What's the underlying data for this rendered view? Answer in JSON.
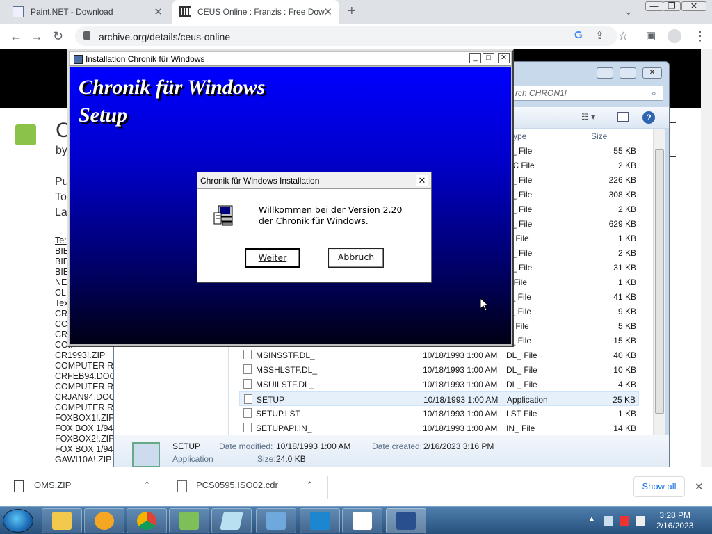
{
  "browser": {
    "tabs": [
      {
        "title": "Paint.NET - Download",
        "close": "✕",
        "active": false
      },
      {
        "title": "CEUS Online : Franzis : Free Dow",
        "close": "✕",
        "active": true
      }
    ],
    "new_tab": "+",
    "url": "archive.org/details/ceus-online",
    "window_controls": [
      "—",
      "❐",
      "✕"
    ]
  },
  "archive_page": {
    "title_partial": "C",
    "by_partial": "by",
    "meta_partial": [
      "Pu",
      "To",
      "La"
    ],
    "files_partial": [
      "Te:",
      "BIE",
      "BIE",
      "BIE",
      "NE",
      "CL",
      "Tex",
      "CR",
      "CC",
      "CR",
      "COM",
      "CR1993!.ZIP",
      "COMPUTER R",
      "CRFEB94.DOC",
      "COMPUTER R",
      "CRJAN94.DOC",
      "COMPUTER R",
      "FOXBOX1!.ZIP",
      "FOX BOX 1/94",
      "FOXBOX2!.ZIP",
      "FOX BOX 1/94",
      "GAWI10A!.ZIP"
    ]
  },
  "explorer": {
    "search_placeholder": "rch CHRON1!",
    "columns": {
      "type": "ype",
      "size": "Size"
    },
    "rows": [
      {
        "name": "",
        "date": "",
        "type": "K_ File",
        "size": "55 KB"
      },
      {
        "name": "",
        "date": "",
        "type": "OC File",
        "size": "2 KB"
      },
      {
        "name": "",
        "date": "",
        "type": "A_ File",
        "size": "226 KB"
      },
      {
        "name": "",
        "date": "",
        "type": "A_ File",
        "size": "308 KB"
      },
      {
        "name": "",
        "date": "",
        "type": "A_ File",
        "size": "2 KB"
      },
      {
        "name": "",
        "date": "",
        "type": "A_ File",
        "size": "629 KB"
      },
      {
        "name": "",
        "date": "",
        "type": "I_ File",
        "size": "1 KB"
      },
      {
        "name": "",
        "date": "",
        "type": "S_ File",
        "size": "2 KB"
      },
      {
        "name": "",
        "date": "",
        "type": "K_ File",
        "size": "31 KB"
      },
      {
        "name": "",
        "date": "",
        "type": "Z File",
        "size": "1 KB"
      },
      {
        "name": "",
        "date": "",
        "type": "L_ File",
        "size": "41 KB"
      },
      {
        "name": "",
        "date": "",
        "type": "L_ File",
        "size": "9 KB"
      },
      {
        "name": "",
        "date": "",
        "type": "I_ File",
        "size": "5 KB"
      },
      {
        "name": "",
        "date": "",
        "type": "L_ File",
        "size": "15 KB"
      },
      {
        "name": "MSINSSTF.DL_",
        "date": "10/18/1993 1:00 AM",
        "type": "DL_ File",
        "size": "40 KB"
      },
      {
        "name": "MSSHLSTF.DL_",
        "date": "10/18/1993 1:00 AM",
        "type": "DL_ File",
        "size": "10 KB"
      },
      {
        "name": "MSUILSTF.DL_",
        "date": "10/18/1993 1:00 AM",
        "type": "DL_ File",
        "size": "4 KB"
      },
      {
        "name": "SETUP",
        "date": "10/18/1993 1:00 AM",
        "type": "Application",
        "size": "25 KB",
        "selected": true
      },
      {
        "name": "SETUP.LST",
        "date": "10/18/1993 1:00 AM",
        "type": "LST File",
        "size": "1 KB"
      },
      {
        "name": "SETUPAPI.IN_",
        "date": "10/18/1993 1:00 AM",
        "type": "IN_ File",
        "size": "14 KB"
      }
    ],
    "details": {
      "name": "SETUP",
      "type": "Application",
      "date_modified_label": "Date modified:",
      "date_modified": "10/18/1993 1:00 AM",
      "date_created_label": "Date created:",
      "date_created": "2/16/2023 3:16 PM",
      "size_label": "Size:",
      "size": "24.0 KB"
    }
  },
  "setup_window": {
    "title": "Installation Chronik für Windows",
    "headline_line1": "Chronik für Windows",
    "headline_line2": "Setup",
    "buttons": [
      "_",
      "□",
      "✕"
    ]
  },
  "dialog": {
    "title": "Chronik für Windows Installation",
    "close": "✕",
    "message_line1": "Willkommen bei der Version 2.20",
    "message_line2": "der Chronik für Windows.",
    "ok_label": "Weiter",
    "cancel_label": "Abbruch"
  },
  "downloads": {
    "items": [
      {
        "name": "OMS.ZIP"
      },
      {
        "name": "PCS0595.ISO02.cdr"
      }
    ],
    "show_all": "Show all",
    "close": "✕"
  },
  "taskbar": {
    "time": "3:28 PM",
    "date": "2/16/2023"
  },
  "colors": {
    "setup_gradient_top": "#0000ff",
    "setup_gradient_bottom": "#000014",
    "link_blue": "#1a73e8",
    "taskbar": "#27507c"
  }
}
